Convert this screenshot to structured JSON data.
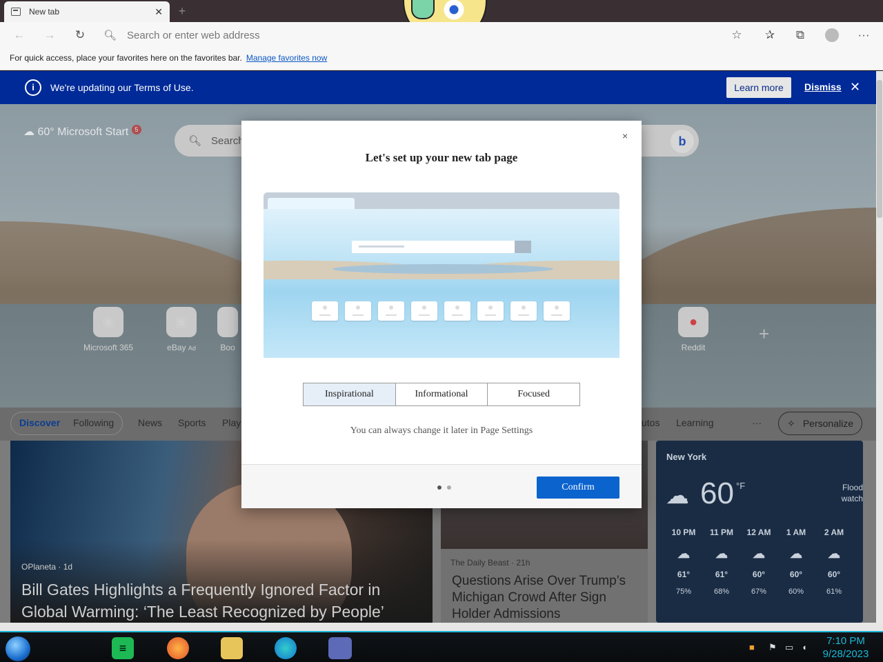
{
  "browser": {
    "tab_title": "New tab",
    "tab_close": "✕",
    "new_tab": "+",
    "address_placeholder": "Search or enter web address",
    "favbar_text": "For quick access, place your favorites here on the favorites bar.",
    "favbar_link": "Manage favorites now"
  },
  "banner": {
    "message": "We're updating our Terms of Use.",
    "learn_more": "Learn more",
    "dismiss": "Dismiss"
  },
  "newtab": {
    "temp": "60°",
    "brand": "Microsoft Start",
    "notifications": "5",
    "search_placeholder": "Search",
    "tiles": [
      "Microsoft 365",
      "eBay",
      "Boo",
      "Reddit"
    ],
    "ad_label": "Ad"
  },
  "feed": {
    "tabs": [
      "Discover",
      "Following",
      "News",
      "Sports",
      "Play",
      "utos",
      "Learning"
    ],
    "more": "···",
    "personalize": "Personalize",
    "card1": {
      "source": "OPlaneta · 1d",
      "title": "Bill Gates Highlights a Frequently Ignored Factor in Global Warming: ‘The Least Recognized by People’"
    },
    "card2": {
      "source": "The Daily Beast · 21h",
      "title": "Questions Arise Over Trump’s Michigan Crowd After Sign Holder Admissions"
    }
  },
  "weather": {
    "location": "New York",
    "temp": "60",
    "unit": "°F",
    "alert": "Flood watch",
    "hours": [
      {
        "time": "10 PM",
        "temp": "61°",
        "hum": "75%"
      },
      {
        "time": "11 PM",
        "temp": "61°",
        "hum": "68%"
      },
      {
        "time": "12 AM",
        "temp": "60°",
        "hum": "67%"
      },
      {
        "time": "1 AM",
        "temp": "60°",
        "hum": "60%"
      },
      {
        "time": "2 AM",
        "temp": "60°",
        "hum": "61%"
      }
    ]
  },
  "modal": {
    "title": "Let's set up your new tab page",
    "options": [
      "Inspirational",
      "Informational",
      "Focused"
    ],
    "selected": "Inspirational",
    "hint": "You can always change it later in Page Settings",
    "confirm": "Confirm",
    "close": "×"
  },
  "taskbar": {
    "time": "7:10 PM",
    "date": "9/28/2023"
  },
  "colors": {
    "banner": "#002a98",
    "confirm": "#0b63ce",
    "accent": "#1ab8d8"
  }
}
